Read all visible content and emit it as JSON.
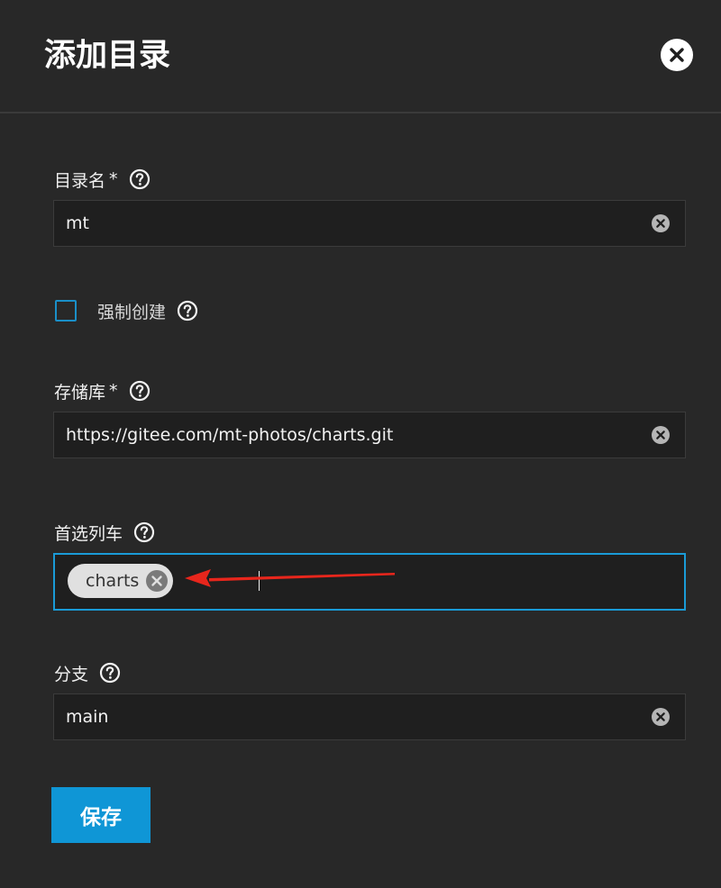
{
  "dialog": {
    "title": "添加目录",
    "close_icon": "close-icon"
  },
  "fields": {
    "catalog_name": {
      "label": "目录名",
      "required_mark": "*",
      "value": "mt"
    },
    "force_create": {
      "label": "强制创建",
      "checked": false
    },
    "repository": {
      "label": "存储库",
      "required_mark": "*",
      "value": "https://gitee.com/mt-photos/charts.git"
    },
    "preferred_trains": {
      "label": "首选列车",
      "chips": [
        "charts"
      ]
    },
    "branch": {
      "label": "分支",
      "value": "main"
    }
  },
  "actions": {
    "save_label": "保存"
  },
  "icons": {
    "help": "help-circle-icon",
    "clear": "clear-circle-icon",
    "chip_remove": "chip-remove-icon"
  },
  "colors": {
    "background": "#282828",
    "field_background": "#1f1f1f",
    "accent": "#0f96d6",
    "focus_border": "#1a9bd7",
    "annotation_arrow": "#e8261c"
  }
}
